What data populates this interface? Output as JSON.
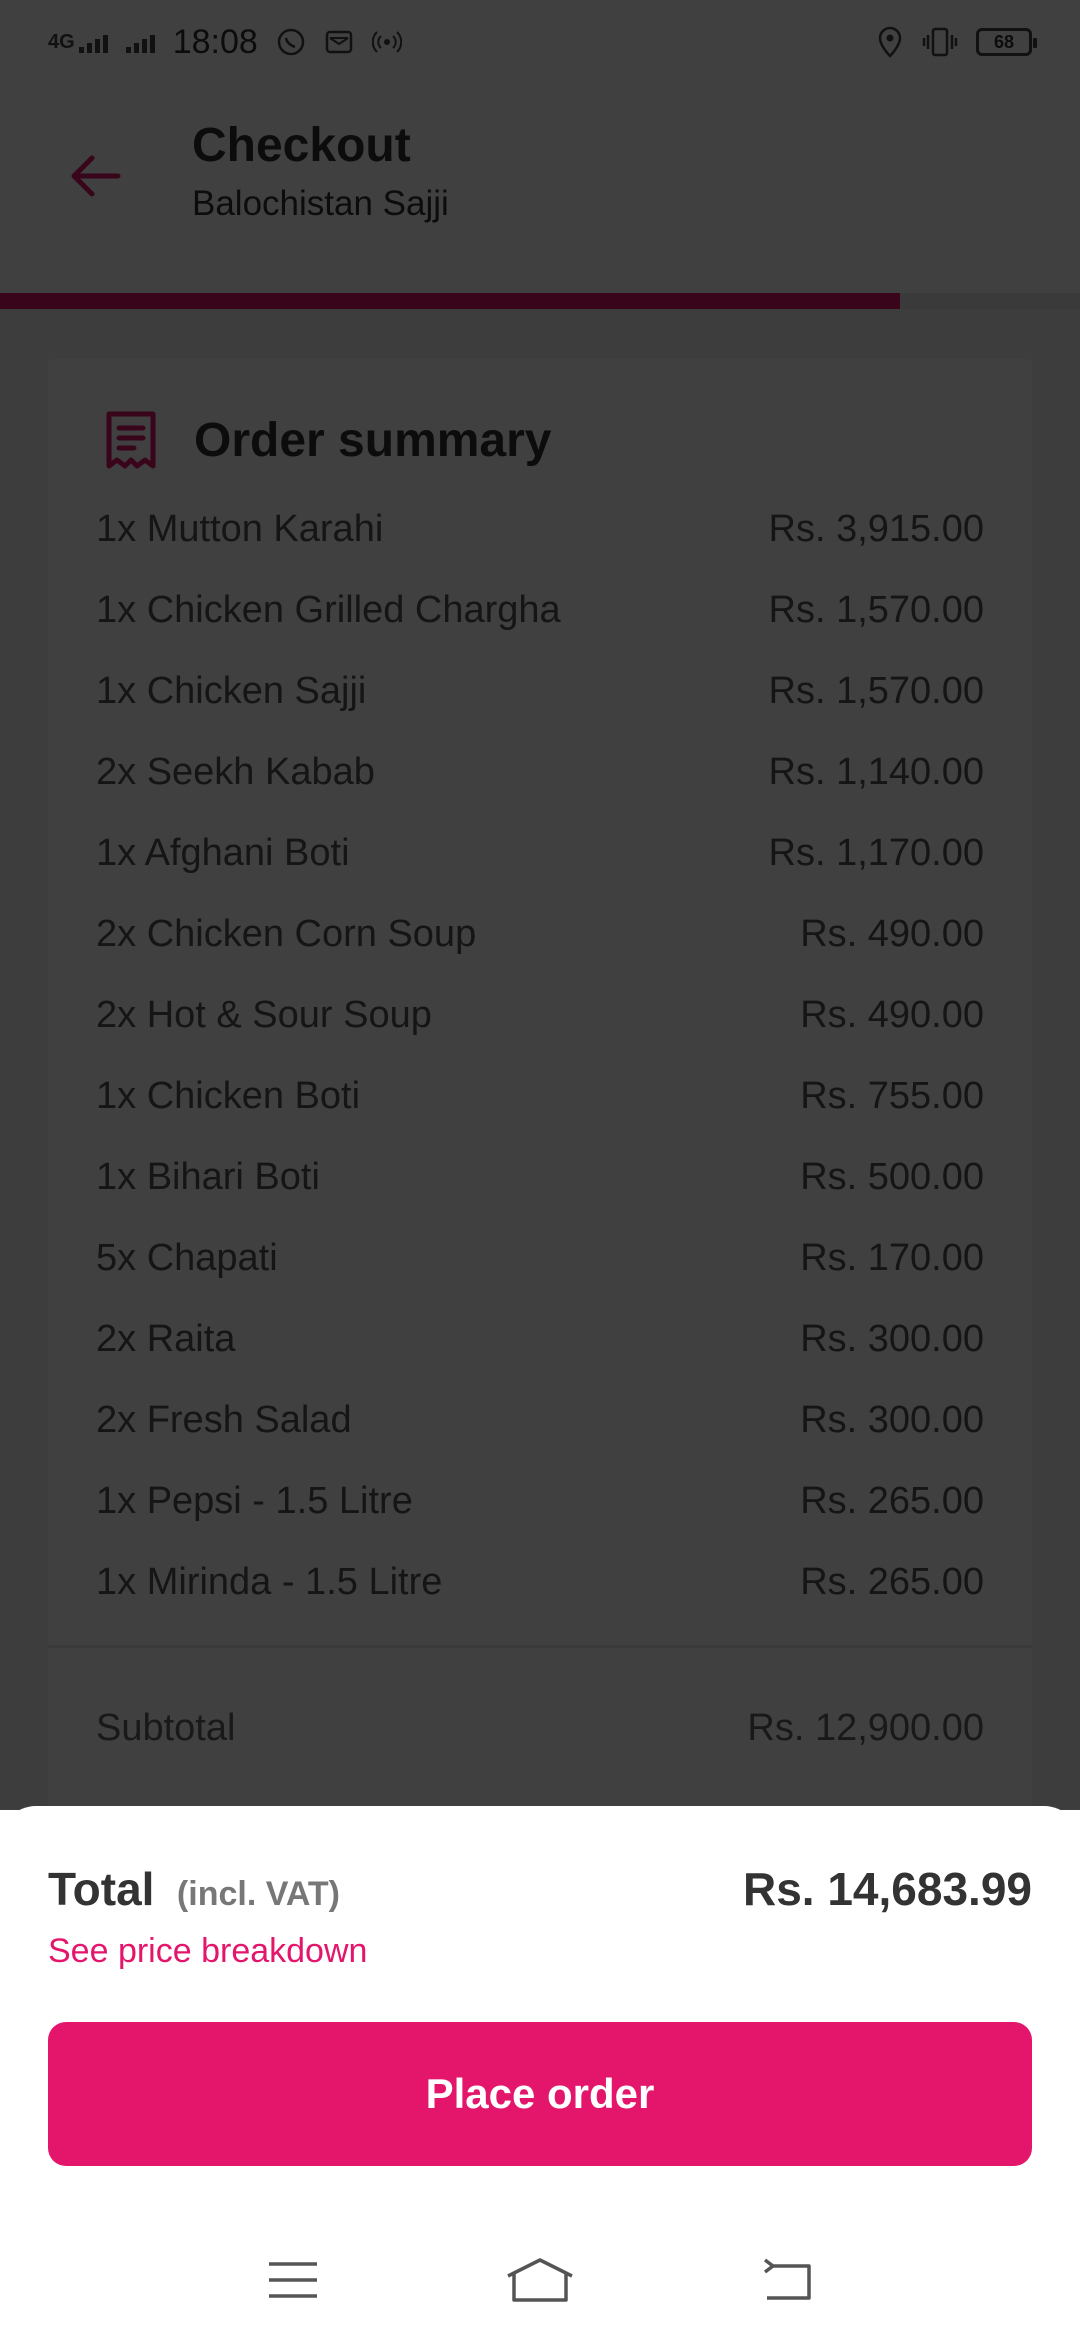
{
  "status_bar": {
    "network": "4G",
    "time": "18:08",
    "battery": "68",
    "icons": [
      "signal-icon",
      "whatsapp-icon",
      "mail-icon",
      "hotspot-icon",
      "location-icon",
      "vibrate-icon",
      "battery-icon"
    ]
  },
  "header": {
    "title": "Checkout",
    "subtitle": "Balochistan Sajji",
    "back_icon": "arrow-left-icon"
  },
  "progress": {
    "value": 0.833
  },
  "order_summary": {
    "title": "Order summary",
    "icon": "receipt-icon",
    "items": [
      {
        "label": "1x Mutton Karahi",
        "price": "Rs. 3,915.00"
      },
      {
        "label": "1x Chicken Grilled Chargha",
        "price": "Rs. 1,570.00"
      },
      {
        "label": "1x Chicken Sajji",
        "price": "Rs. 1,570.00"
      },
      {
        "label": "2x Seekh Kabab",
        "price": "Rs. 1,140.00"
      },
      {
        "label": "1x Afghani Boti",
        "price": "Rs. 1,170.00"
      },
      {
        "label": "2x Chicken Corn Soup",
        "price": "Rs. 490.00"
      },
      {
        "label": "2x Hot & Sour Soup",
        "price": "Rs. 490.00"
      },
      {
        "label": "1x Chicken Boti",
        "price": "Rs. 755.00"
      },
      {
        "label": "1x Bihari Boti",
        "price": "Rs. 500.00"
      },
      {
        "label": "5x Chapati",
        "price": "Rs. 170.00"
      },
      {
        "label": "2x Raita",
        "price": "Rs. 300.00"
      },
      {
        "label": "2x Fresh Salad",
        "price": "Rs. 300.00"
      },
      {
        "label": "1x Pepsi - 1.5 Litre",
        "price": "Rs. 265.00"
      },
      {
        "label": "1x Mirinda - 1.5 Litre",
        "price": "Rs. 265.00"
      }
    ],
    "subtotal_label": "Subtotal",
    "subtotal_value": "Rs. 12,900.00"
  },
  "bottom": {
    "total_label": "Total",
    "total_vat": "(incl. VAT)",
    "total_amount": "Rs. 14,683.99",
    "breakdown_link": "See price breakdown",
    "place_order": "Place order"
  },
  "nav": {
    "icons": [
      "menu-icon",
      "home-icon",
      "back-icon"
    ]
  },
  "colors": {
    "accent": "#e4166c",
    "overlay": "rgba(0,0,0,0.75)"
  }
}
